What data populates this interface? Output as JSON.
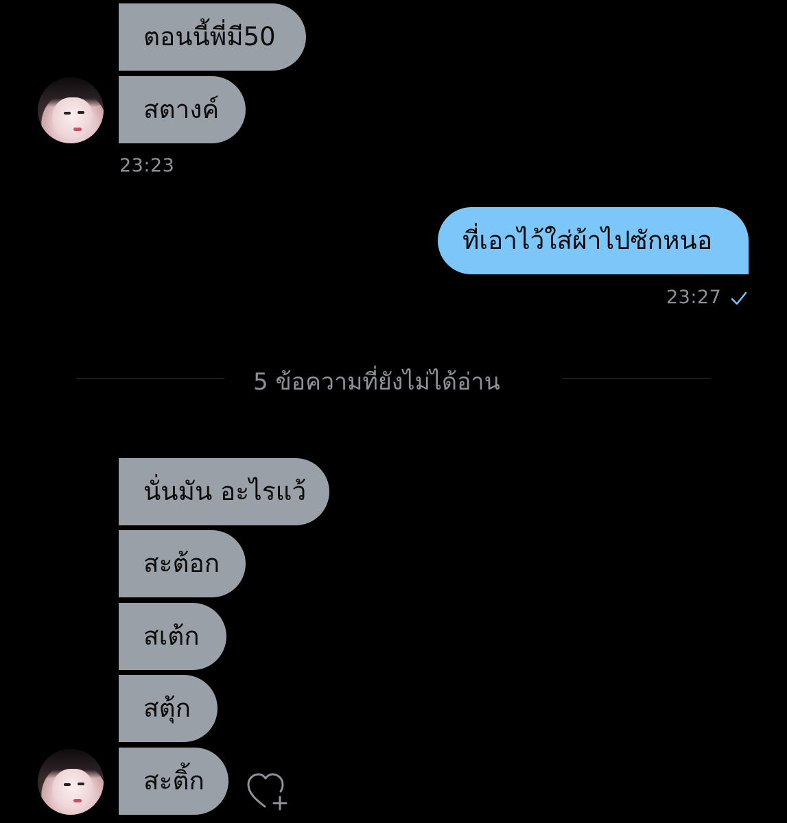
{
  "messages": {
    "group1": {
      "bubble1": "ตอนนี้พี่มี50",
      "bubble2": "สตางค์",
      "time": "23:23"
    },
    "sent": {
      "text": "ที่เอาไว้ใส่ผ้าไปซักหนอ",
      "time": "23:27",
      "status_icon": "check-icon"
    },
    "unread_divider": "5 ข้อความที่ยังไม่ได้อ่าน",
    "group2": {
      "bubble1": "นั่นมัน อะไรแว้",
      "bubble2": "สะต้อก",
      "bubble3": "สเต้ก",
      "bubble4": "สตุ้ก",
      "bubble5": "สะติ้ก"
    }
  },
  "colors": {
    "background": "#000000",
    "received_bubble": "#9aa0a8",
    "sent_bubble": "#7cc6fa",
    "timestamp": "#8e9196",
    "check": "#7cc6fa"
  },
  "icons": [
    "avatar",
    "check-icon",
    "heart-add-icon"
  ]
}
